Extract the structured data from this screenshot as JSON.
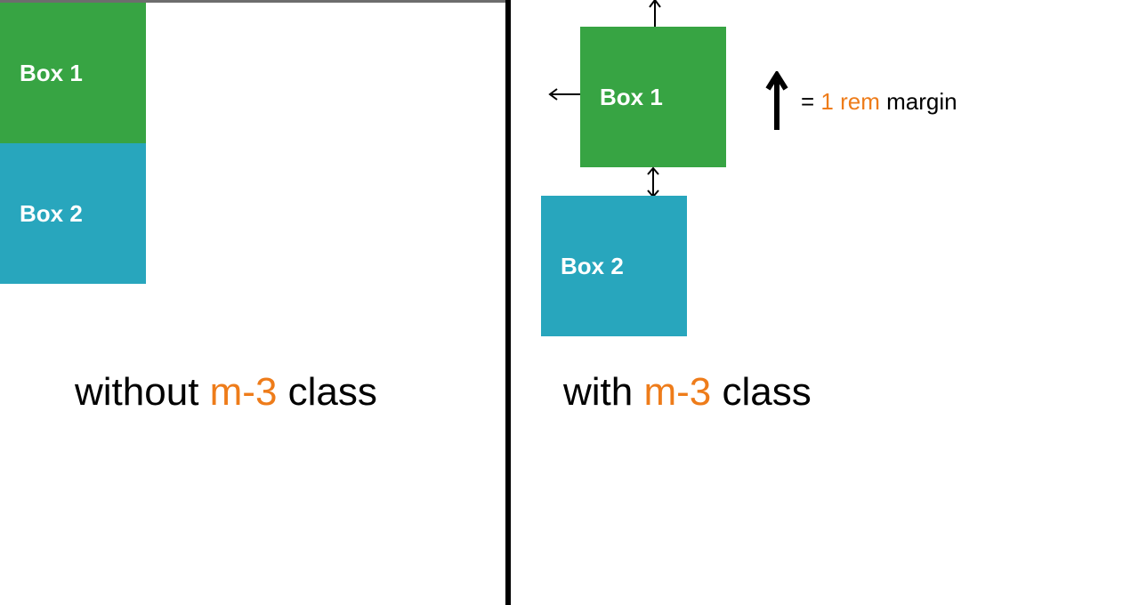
{
  "boxes": {
    "box1_label": "Box 1",
    "box2_label": "Box 2"
  },
  "captions": {
    "left_prefix": "without ",
    "right_prefix": "with ",
    "class_code": "m-3",
    "class_suffix": " class"
  },
  "legend": {
    "equals": "= ",
    "value_code": "1 rem",
    "suffix": " margin"
  },
  "colors": {
    "green": "#37a443",
    "teal": "#28a6bd",
    "orange": "#ee7c1a"
  }
}
